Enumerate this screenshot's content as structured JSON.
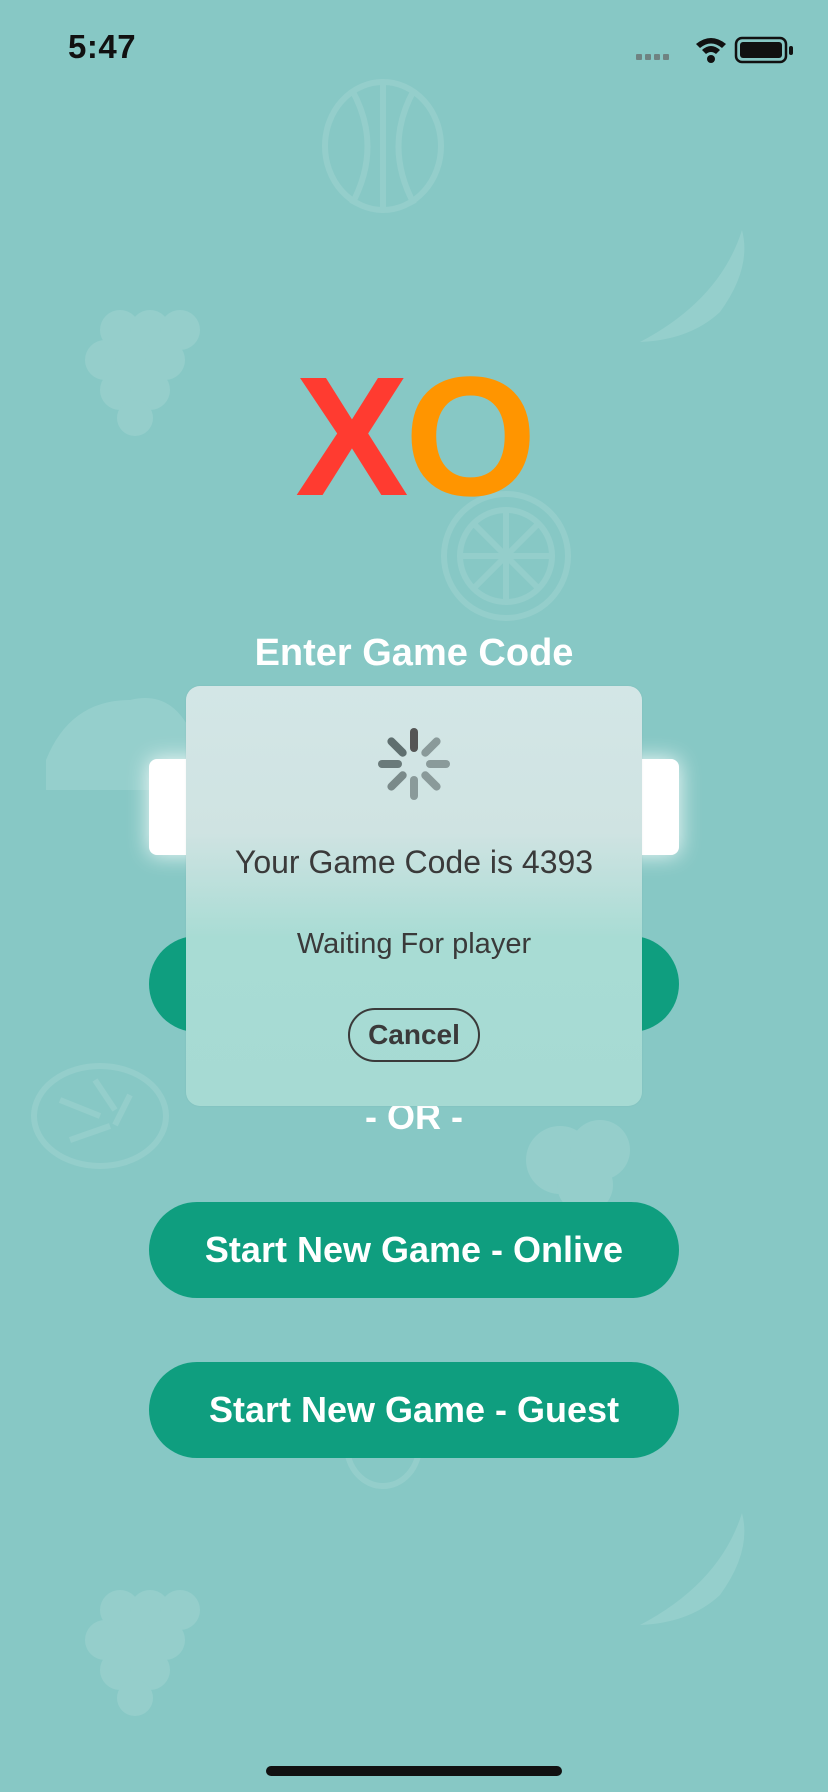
{
  "status_bar": {
    "time": "5:47",
    "icons": [
      "signal-icon",
      "wifi-icon",
      "battery-icon"
    ]
  },
  "logo": {
    "x": "X",
    "o": "O",
    "x_color": "#ff3b30",
    "o_color": "#ff9500"
  },
  "join": {
    "title": "Enter Game Code",
    "input_value": "",
    "button_label": ""
  },
  "or_label": "- OR -",
  "buttons": {
    "online": "Start New Game - Onlive",
    "guest": "Start New Game - Guest"
  },
  "modal": {
    "code_text": "Your Game Code is 4393",
    "waiting_text": "Waiting For player",
    "cancel_label": "Cancel"
  },
  "colors": {
    "background": "#87c8c5",
    "button": "#0f9e7f",
    "text_white": "#ffffff"
  }
}
